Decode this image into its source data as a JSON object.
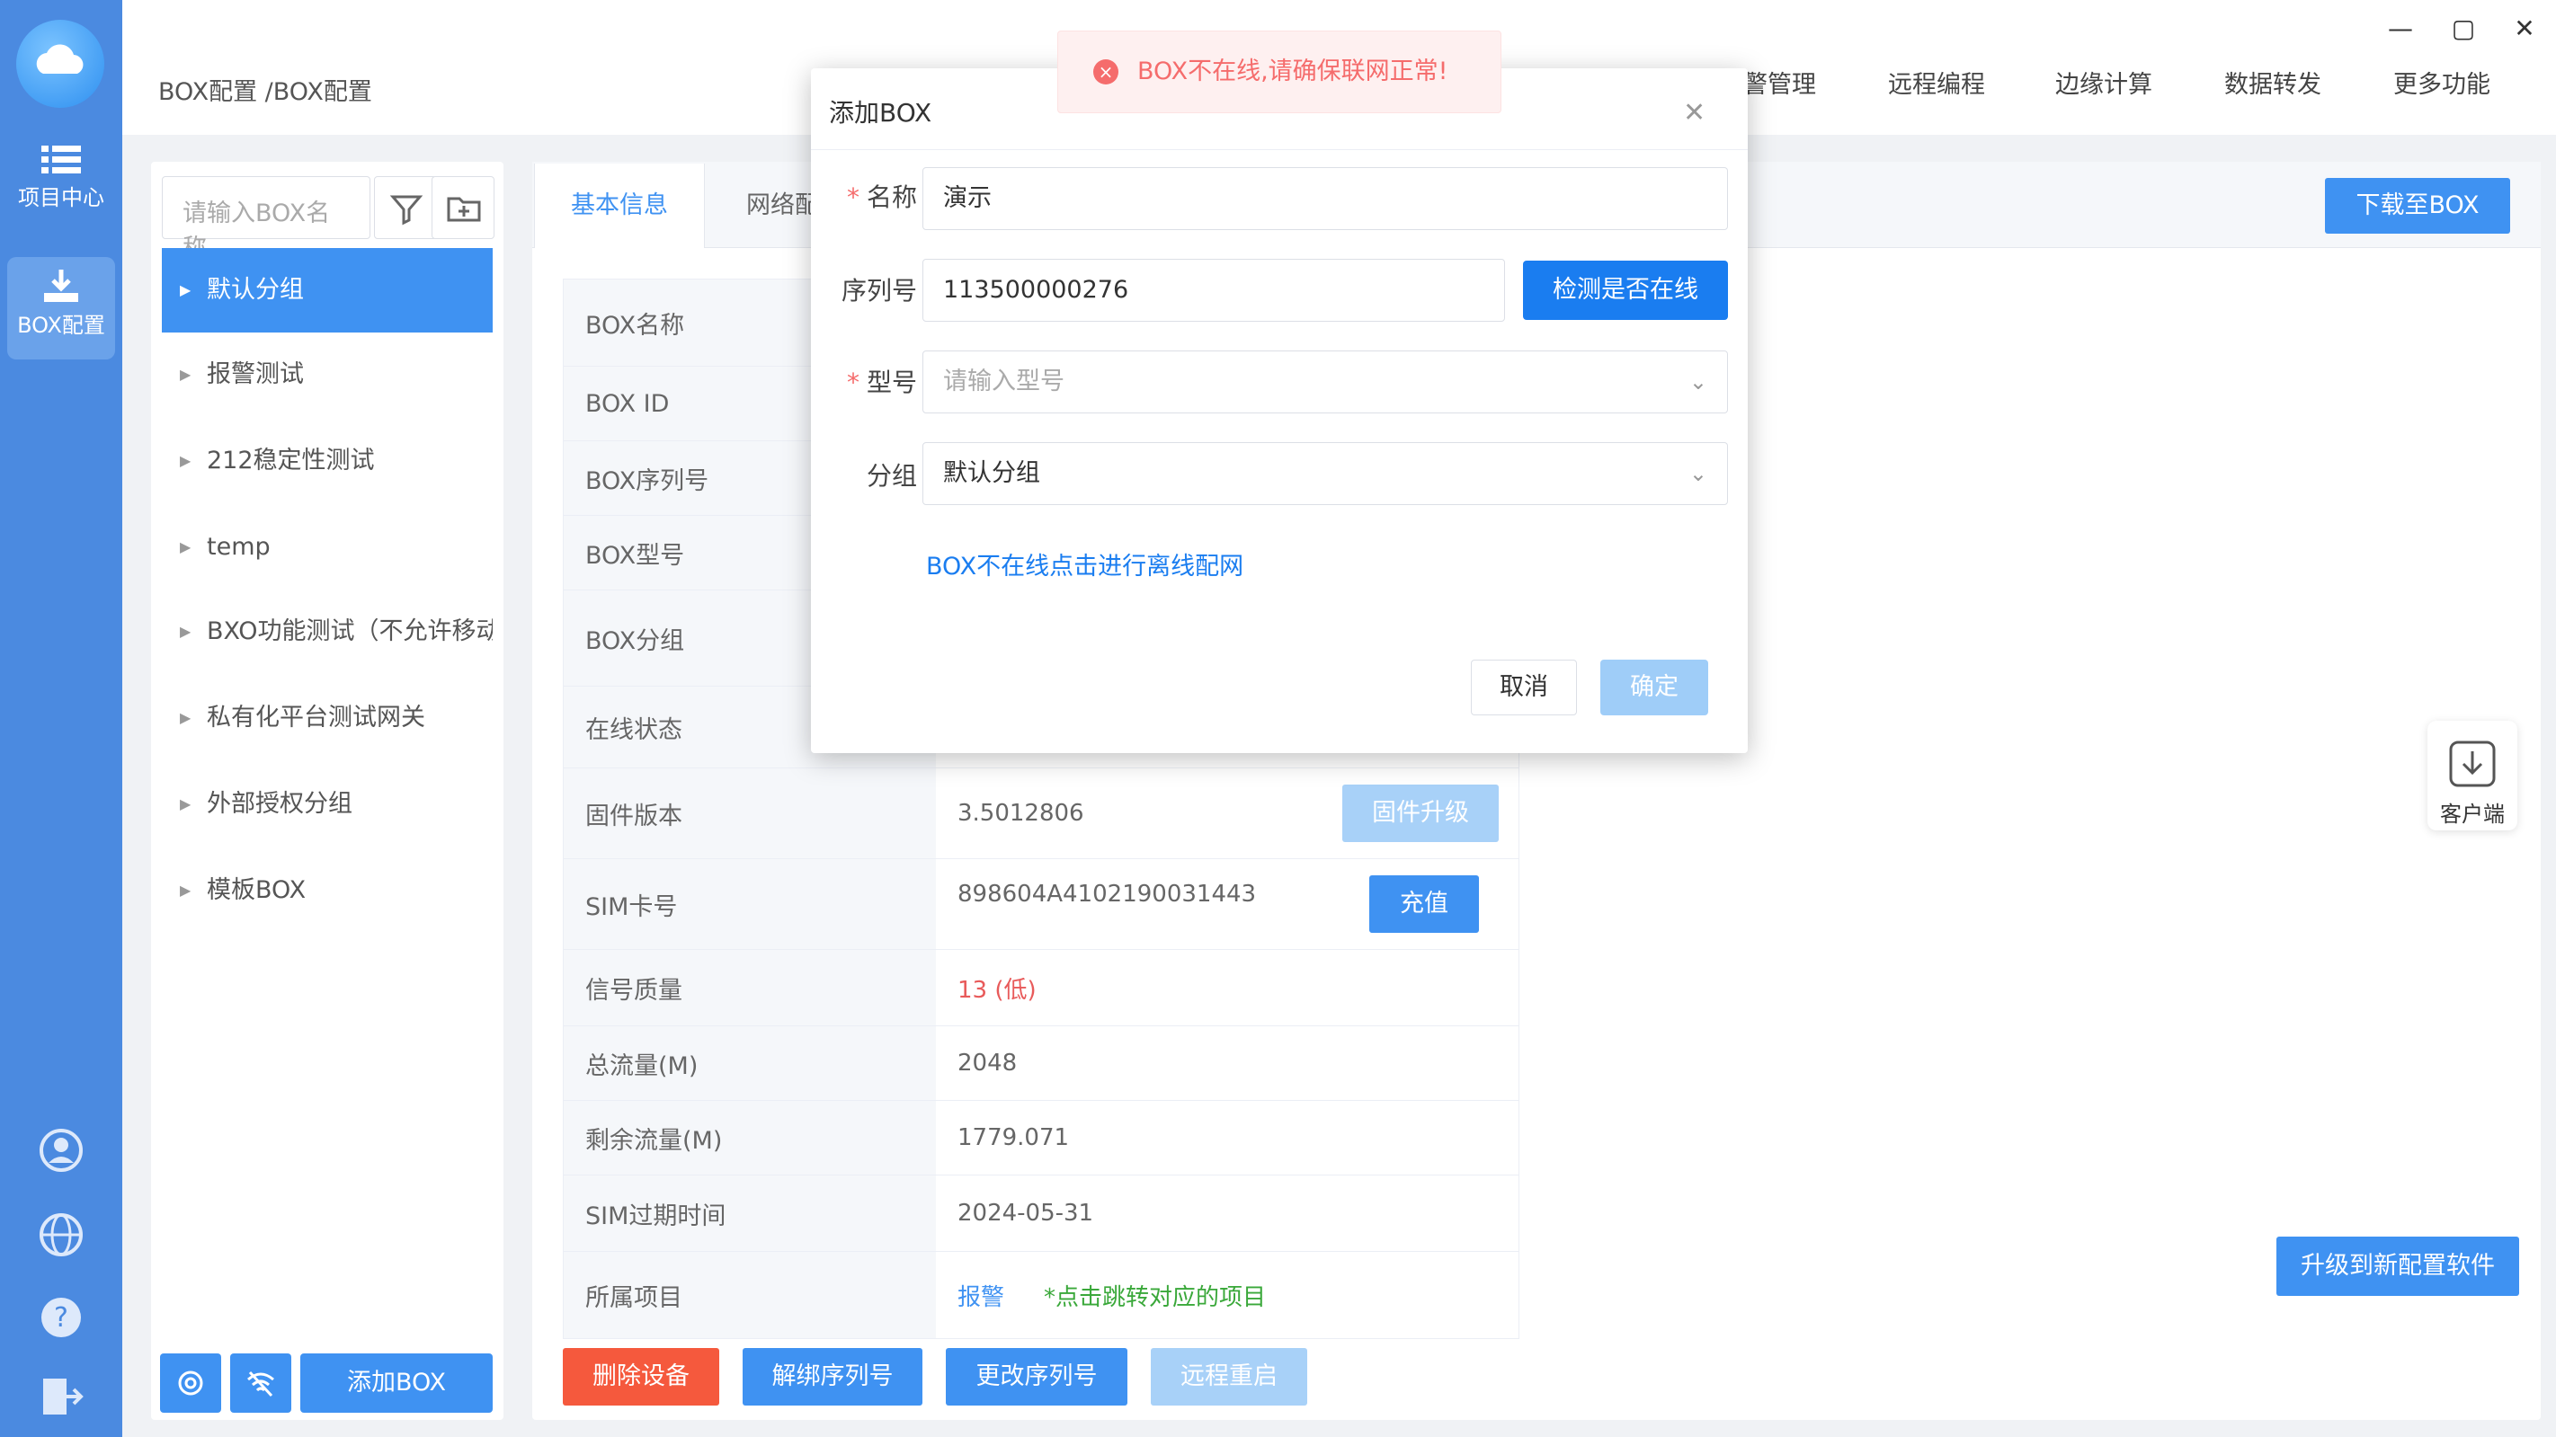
{
  "nav": {
    "project_center": "项目中心",
    "box_config": "BOX配置"
  },
  "header": {
    "breadcrumb": "BOX配置 /BOX配置",
    "topnav": [
      "报警管理",
      "远程编程",
      "边缘计算",
      "数据转发",
      "更多功能"
    ]
  },
  "sidebar": {
    "search_placeholder": "请输入BOX名称",
    "groups": [
      "默认分组",
      "报警测试",
      "212稳定性测试",
      "temp",
      "BXO功能测试（不允许移动）",
      "私有化平台测试网关",
      "外部授权分组",
      "模板BOX"
    ],
    "add_box": "添加BOX"
  },
  "tabs": [
    "基本信息",
    "网络配置"
  ],
  "download_btn": "下载至BOX",
  "info": {
    "rows": [
      {
        "label": "BOX名称",
        "value": ""
      },
      {
        "label": "BOX ID",
        "value": ""
      },
      {
        "label": "BOX序列号",
        "value": ""
      },
      {
        "label": "BOX型号",
        "value": ""
      },
      {
        "label": "BOX分组",
        "value": ""
      },
      {
        "label": "在线状态",
        "value": ""
      },
      {
        "label": "固件版本",
        "value": "3.5012806"
      },
      {
        "label": "SIM卡号",
        "value": "898604A4102190031443"
      },
      {
        "label": "信号质量",
        "value": "13 (低)"
      },
      {
        "label": "总流量(M)",
        "value": "2048"
      },
      {
        "label": "剩余流量(M)",
        "value": "1779.071"
      },
      {
        "label": "SIM过期时间",
        "value": "2024-05-31"
      },
      {
        "label": "所属项目",
        "value": "报警"
      }
    ],
    "firmware_upgrade": "固件升级",
    "recharge": "充值",
    "project_hint": "*点击跳转对应的项目"
  },
  "actions": {
    "delete": "删除设备",
    "unbind": "解绑序列号",
    "change_serial": "更改序列号",
    "remote_restart": "远程重启"
  },
  "client": "客户端",
  "upgrade_software": "升级到新配置软件",
  "dialog": {
    "title": "添加BOX",
    "name_label": "名称",
    "name_value": "演示",
    "serial_label": "序列号",
    "serial_value": "113500000276",
    "check_online": "检测是否在线",
    "model_label": "型号",
    "model_placeholder": "请输入型号",
    "group_label": "分组",
    "group_value": "默认分组",
    "offline_link": "BOX不在线点击进行离线配网",
    "cancel": "取消",
    "confirm": "确定"
  },
  "toast": "BOX不在线,请确保联网正常!",
  "colors": {
    "primary": "#3f92f2",
    "danger": "#f5593d",
    "signal_low": "#e85a5a",
    "hint_green": "#3aa83a"
  }
}
